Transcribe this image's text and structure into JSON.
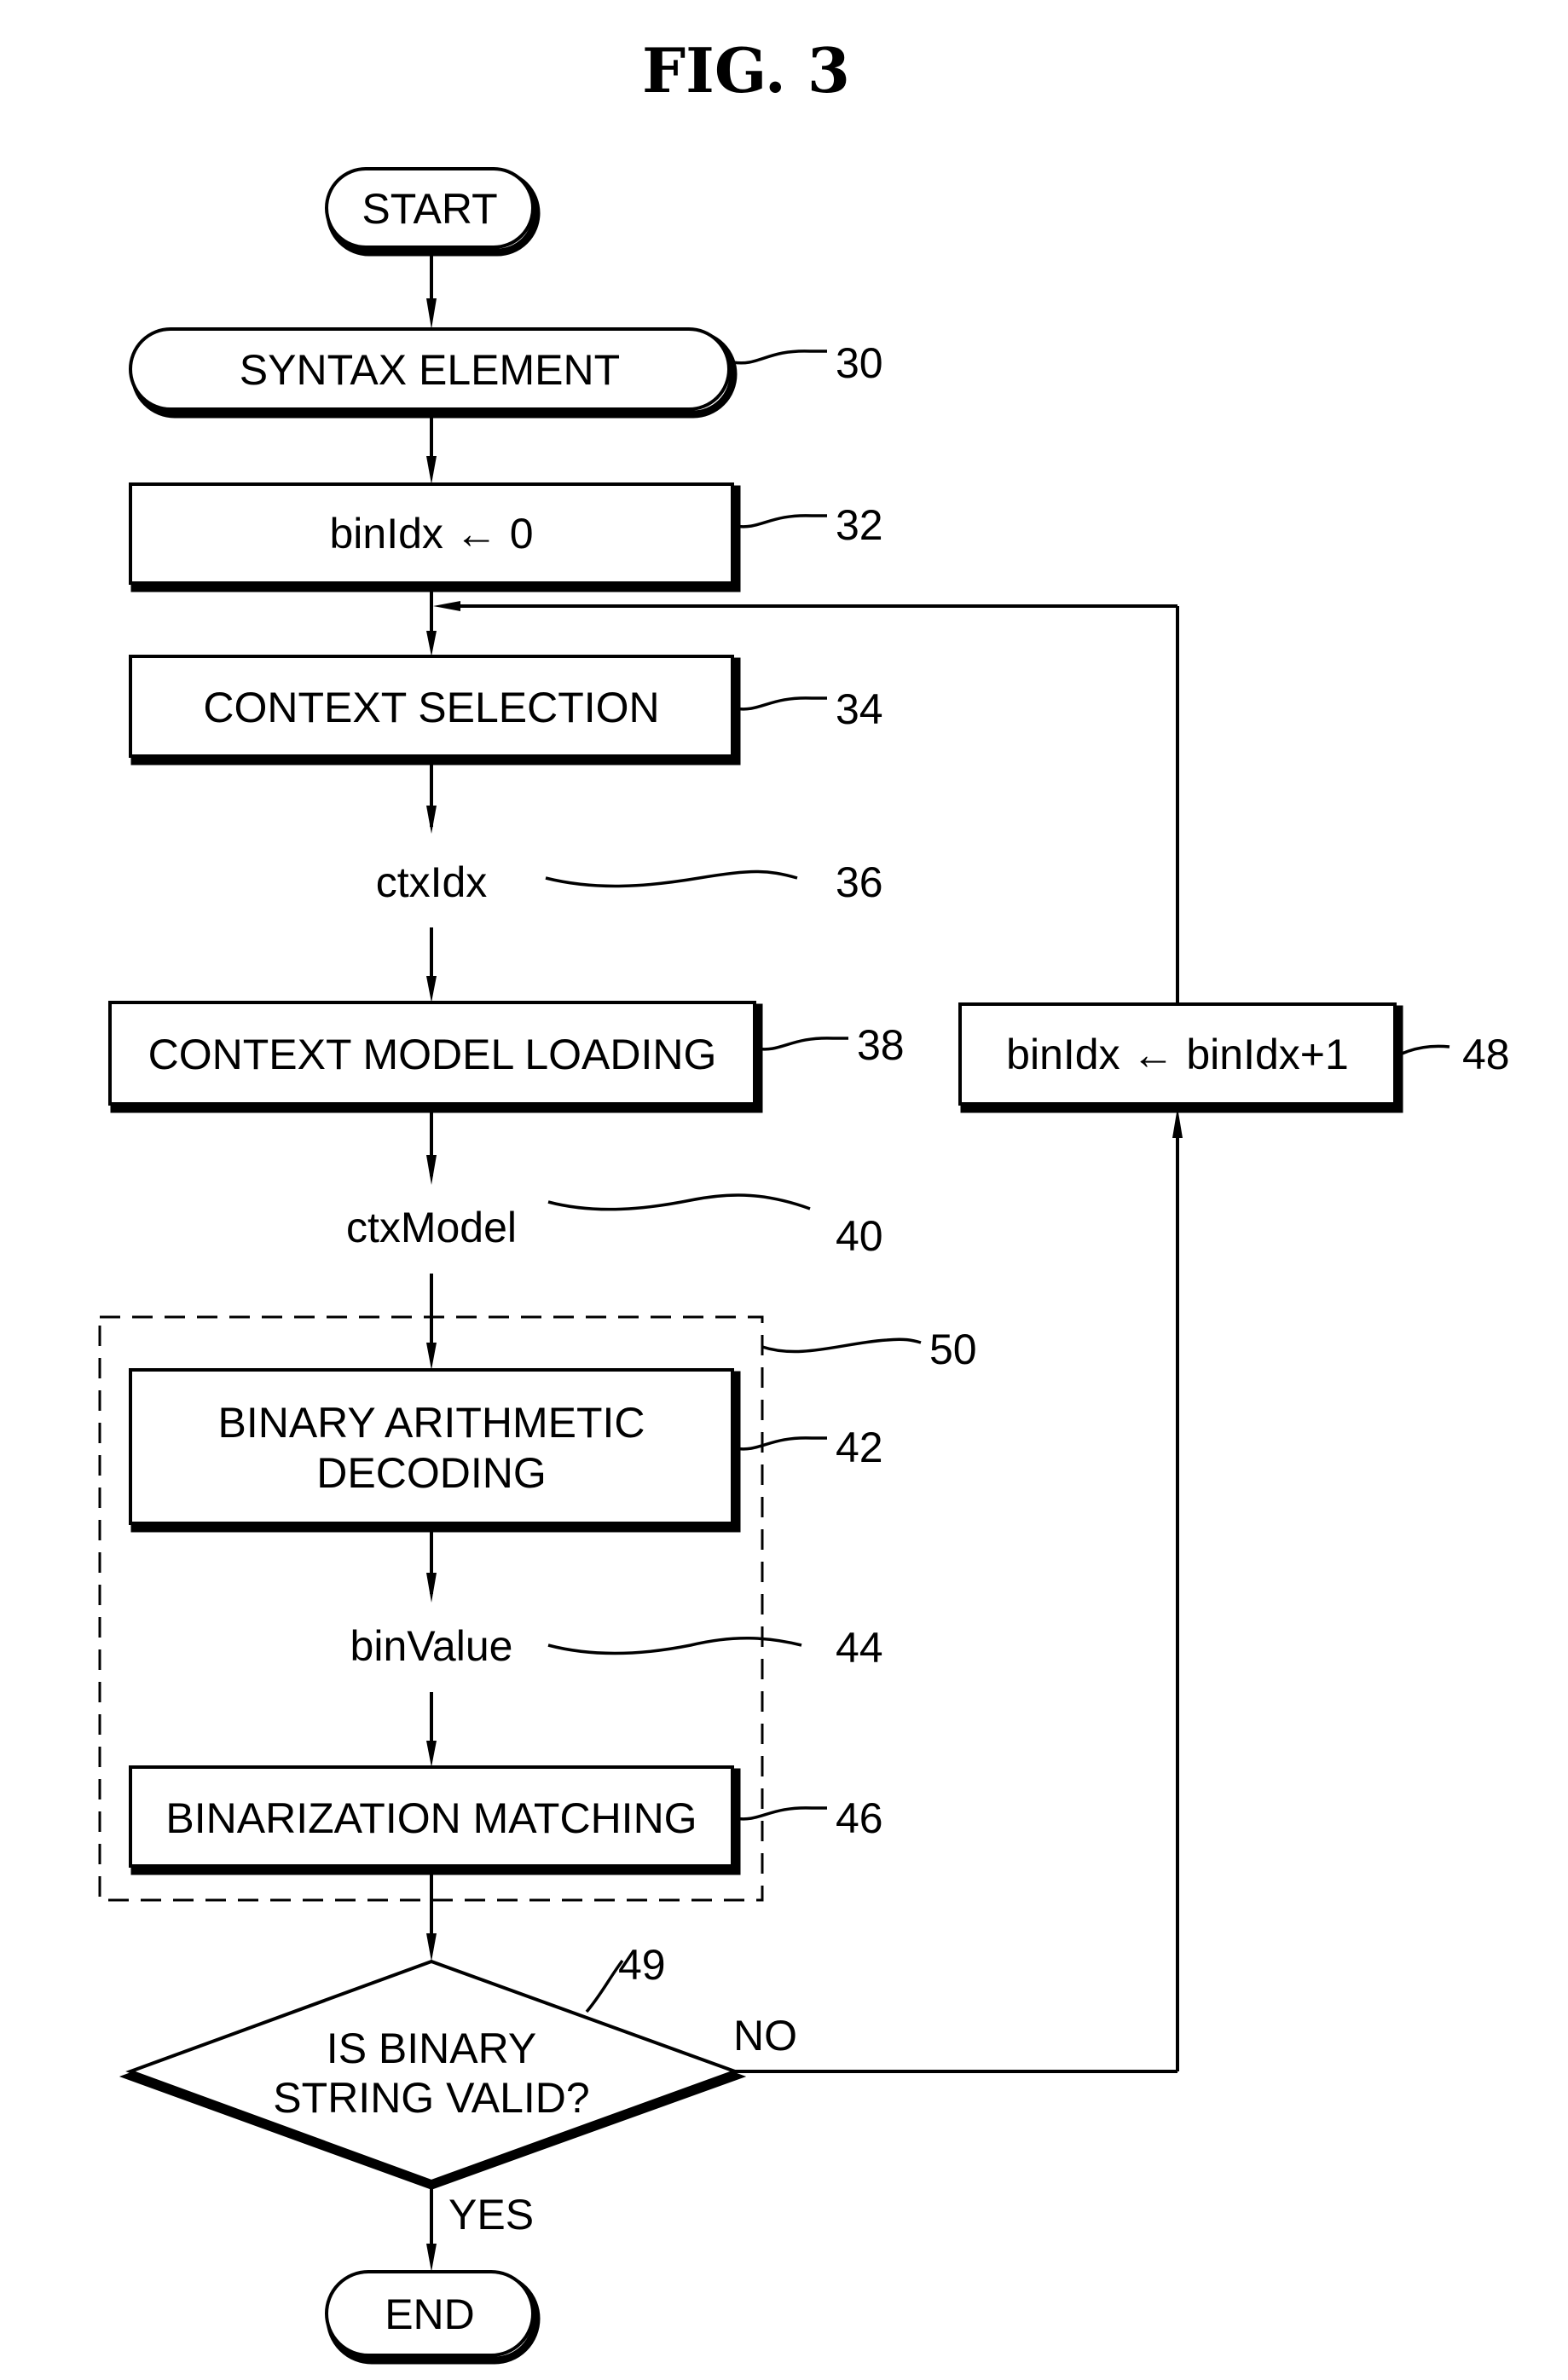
{
  "figure": {
    "title": "FIG. 3"
  },
  "nodes": {
    "start": {
      "label": "START"
    },
    "syntax_element": {
      "label": "SYNTAX ELEMENT",
      "ref": "30"
    },
    "init_binidx": {
      "label": "binIdx ← 0",
      "ref": "32"
    },
    "context_selection": {
      "label": "CONTEXT SELECTION",
      "ref": "34"
    },
    "ctxidx": {
      "label": "ctxIdx",
      "ref": "36"
    },
    "context_model_loading": {
      "label": "CONTEXT MODEL LOADING",
      "ref": "38"
    },
    "ctxmodel": {
      "label": "ctxModel",
      "ref": "40"
    },
    "binary_arithmetic_decoding": {
      "label_line1": "BINARY ARITHMETIC",
      "label_line2": "DECODING",
      "ref": "42"
    },
    "binvalue": {
      "label": "binValue",
      "ref": "44"
    },
    "binarization_matching": {
      "label": "BINARIZATION MATCHING",
      "ref": "46"
    },
    "increment_binidx": {
      "label": "binIdx ← binIdx+1",
      "ref": "48"
    },
    "decision": {
      "label_line1": "IS BINARY",
      "label_line2": "STRING VALID?",
      "ref": "49",
      "no_label": "NO",
      "yes_label": "YES"
    },
    "decoding_group": {
      "ref": "50"
    },
    "end": {
      "label": "END"
    }
  }
}
